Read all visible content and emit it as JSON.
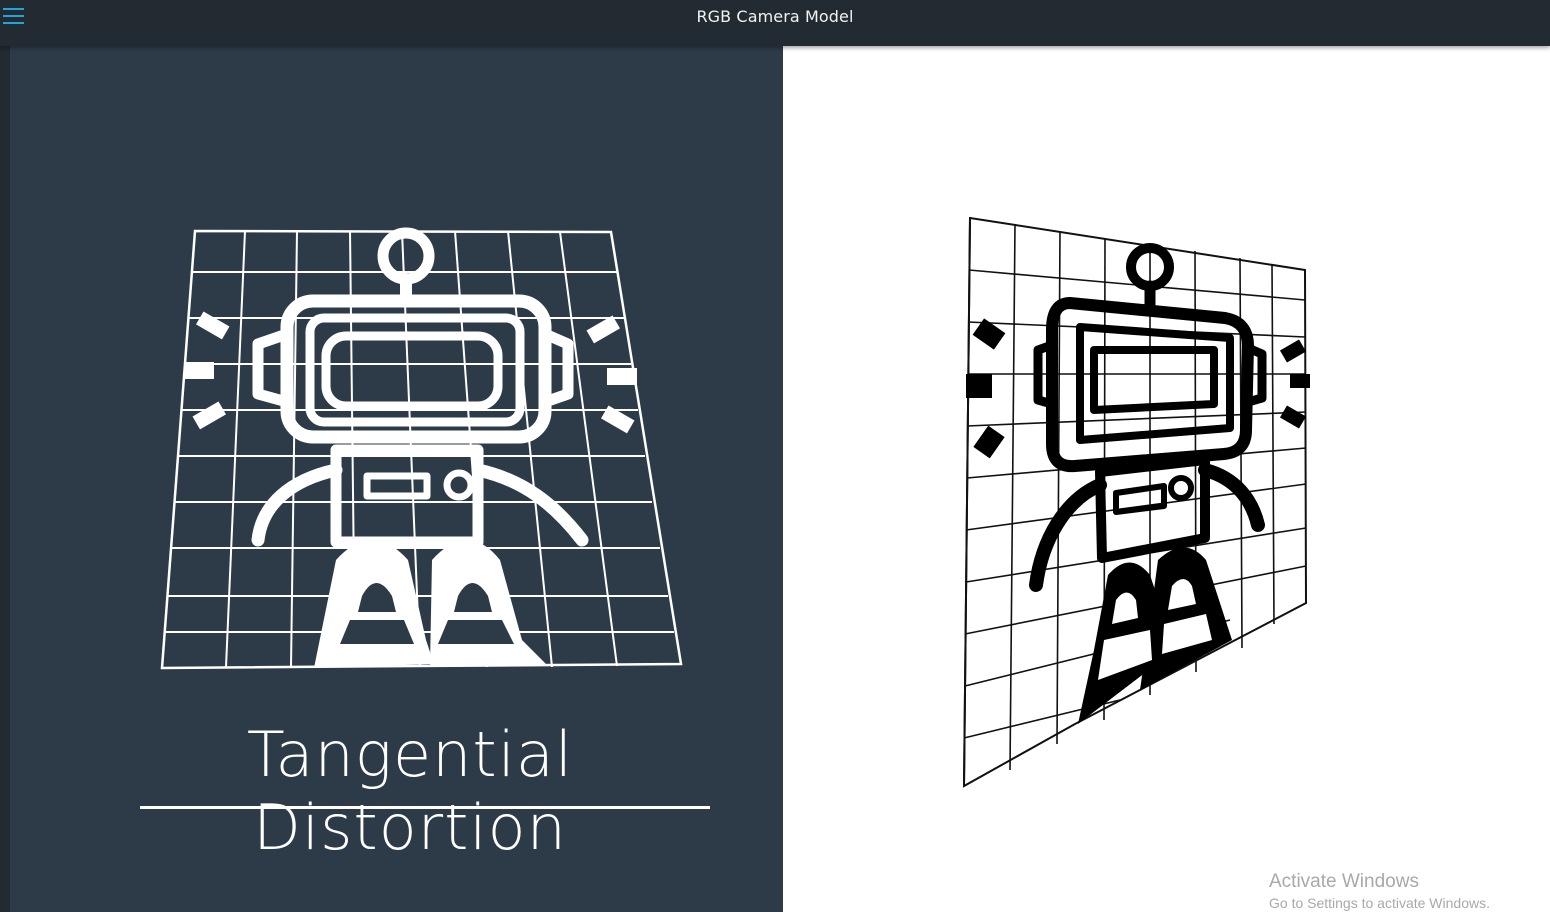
{
  "window": {
    "title": "RGB Camera Model"
  },
  "icons": {
    "menu": "hamburger-menu-icon"
  },
  "colors": {
    "topbar": "#222b31",
    "accent": "#27a3dc",
    "slide_left_bg": "#2d3b49",
    "slide_right_bg": "#ffffff"
  },
  "slides": {
    "left": {
      "heading": "Tangential Distortion",
      "illustration": "robot-on-grid"
    },
    "right": {
      "illustration": "distorted-robot-on-grid"
    }
  },
  "watermark": {
    "line1": "Activate Windows",
    "line2": "Go to Settings to activate Windows."
  }
}
